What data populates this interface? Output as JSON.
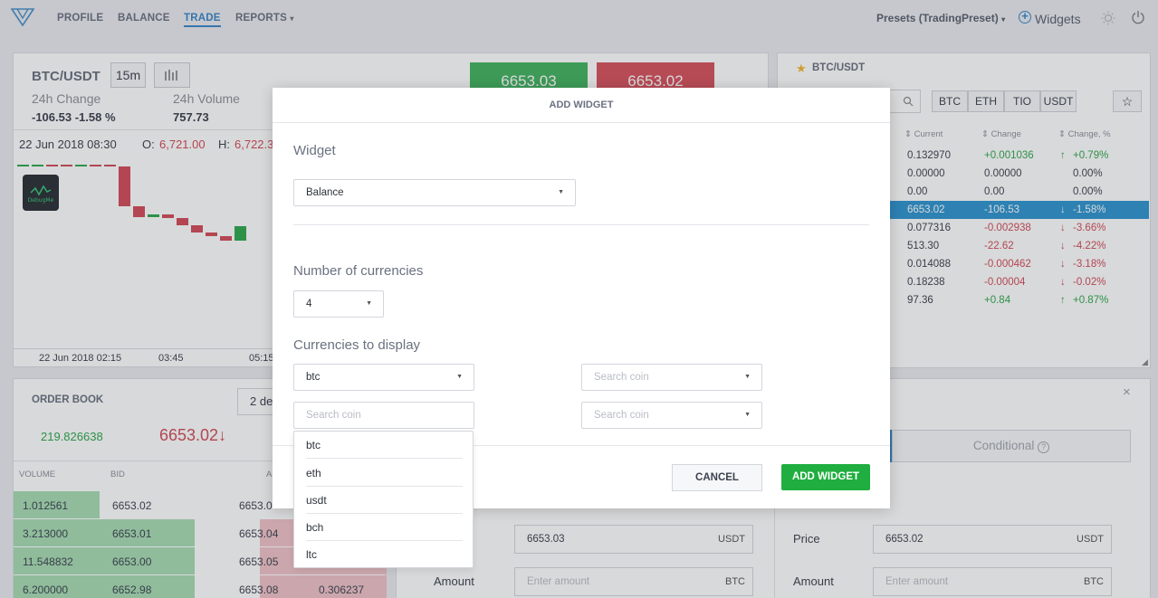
{
  "nav": {
    "items": [
      "PROFILE",
      "BALANCE",
      "TRADE",
      "REPORTS"
    ],
    "reports_caret": "▾",
    "presets": "Presets (TradingPreset)",
    "presets_caret": "▾",
    "widgets": "Widgets"
  },
  "chart": {
    "pair": "BTC/USDT",
    "interval": "15m",
    "change_label": "24h Change",
    "change_value": "-106.53 -1.58 %",
    "volume_label": "24h Volume",
    "volume_value": "757.73",
    "buy_price": "6653.03",
    "sell_price": "6653.02",
    "date": "22 Jun 2018 08:30",
    "o_label": "O:",
    "o_value": "6,721.00",
    "h_label": "H:",
    "h_value": "6,722.3",
    "x_ticks": [
      "22 Jun 2018 02:15",
      "03:45",
      "05:15"
    ],
    "logo_text": "DebugMe",
    "chart_data": {
      "type": "candlestick",
      "candles": [
        {
          "o": 6721.0,
          "c": 6721.0,
          "dir": "up"
        },
        {
          "o": 6721.0,
          "c": 6721.0,
          "dir": "up"
        },
        {
          "o": 6721.0,
          "c": 6720.5,
          "dir": "down"
        },
        {
          "o": 6720.5,
          "c": 6720.5,
          "dir": "down"
        },
        {
          "o": 6720.5,
          "c": 6721.0,
          "dir": "up"
        },
        {
          "o": 6721.0,
          "c": 6720.5,
          "dir": "down"
        },
        {
          "o": 6720.5,
          "c": 6719.5,
          "dir": "down"
        },
        {
          "o": 6719.5,
          "c": 6685.0,
          "dir": "down"
        },
        {
          "o": 6685.0,
          "c": 6676.0,
          "dir": "down"
        },
        {
          "o": 6676.0,
          "c": 6678.0,
          "dir": "up"
        },
        {
          "o": 6678.0,
          "c": 6675.0,
          "dir": "down"
        },
        {
          "o": 6675.0,
          "c": 6669.0,
          "dir": "down"
        },
        {
          "o": 6669.0,
          "c": 6663.0,
          "dir": "down"
        },
        {
          "o": 6663.0,
          "c": 6660.0,
          "dir": "down"
        },
        {
          "o": 6660.0,
          "c": 6656.0,
          "dir": "down"
        },
        {
          "o": 6656.0,
          "c": 6668.0,
          "dir": "up"
        }
      ]
    }
  },
  "market": {
    "title": "BTC/USDT",
    "tabs": [
      "BTC",
      "ETH",
      "TIO",
      "USDT"
    ],
    "headers": [
      "Current",
      "Change",
      "Change, %"
    ],
    "rows": [
      {
        "cur": "0.132970",
        "chg": "+0.001036",
        "pct": "+0.79%",
        "dir": "up"
      },
      {
        "cur": "0.00000",
        "chg": "0.00000",
        "pct": "0.00%",
        "dir": "none"
      },
      {
        "cur": "0.00",
        "chg": "0.00",
        "pct": "0.00%",
        "dir": "none"
      },
      {
        "cur": "6653.02",
        "chg": "-106.53",
        "pct": "-1.58%",
        "dir": "down",
        "selected": true
      },
      {
        "cur": "0.077316",
        "chg": "-0.002938",
        "pct": "-3.66%",
        "dir": "down"
      },
      {
        "cur": "513.30",
        "chg": "-22.62",
        "pct": "-4.22%",
        "dir": "down"
      },
      {
        "cur": "0.014088",
        "chg": "-0.000462",
        "pct": "-3.18%",
        "dir": "down"
      },
      {
        "cur": "0.18238",
        "chg": "-0.00004",
        "pct": "-0.02%",
        "dir": "down"
      },
      {
        "cur": "97.36",
        "chg": "+0.84",
        "pct": "+0.87%",
        "dir": "up"
      }
    ]
  },
  "orderbook": {
    "title": "ORDER BOOK",
    "decimals": "2 de",
    "volume_total": "219.826638",
    "last_price": "6653.02",
    "last_arrow": "↓",
    "headers": [
      "VOLUME",
      "BID",
      "A"
    ],
    "rows": [
      {
        "vol": "1.012561",
        "bid": "6653.02",
        "ask": "6653.0",
        "askvol": ""
      },
      {
        "vol": "3.213000",
        "bid": "6653.01",
        "ask": "6653.04",
        "askvol": ""
      },
      {
        "vol": "11.548832",
        "bid": "6653.00",
        "ask": "6653.05",
        "askvol": ""
      },
      {
        "vol": "6.200000",
        "bid": "6652.98",
        "ask": "6653.08",
        "askvol": "0.306237"
      }
    ]
  },
  "trade": {
    "conditional": "Conditional",
    "help": "?",
    "buy_price": "6653.03",
    "sell_price": "6653.02",
    "price_label": "Price",
    "amount_label": "Amount",
    "amount_placeholder": "Enter amount",
    "usdt": "USDT",
    "btc": "BTC"
  },
  "modal": {
    "title": "ADD WIDGET",
    "widget_label": "Widget",
    "widget_value": "Balance",
    "num_label": "Number of currencies",
    "num_value": "4",
    "cur_label": "Currencies to display",
    "cur1": "btc",
    "search_placeholder": "Search coin",
    "options": [
      "btc",
      "eth",
      "usdt",
      "bch",
      "ltc"
    ],
    "cancel": "CANCEL",
    "add": "ADD WIDGET"
  }
}
